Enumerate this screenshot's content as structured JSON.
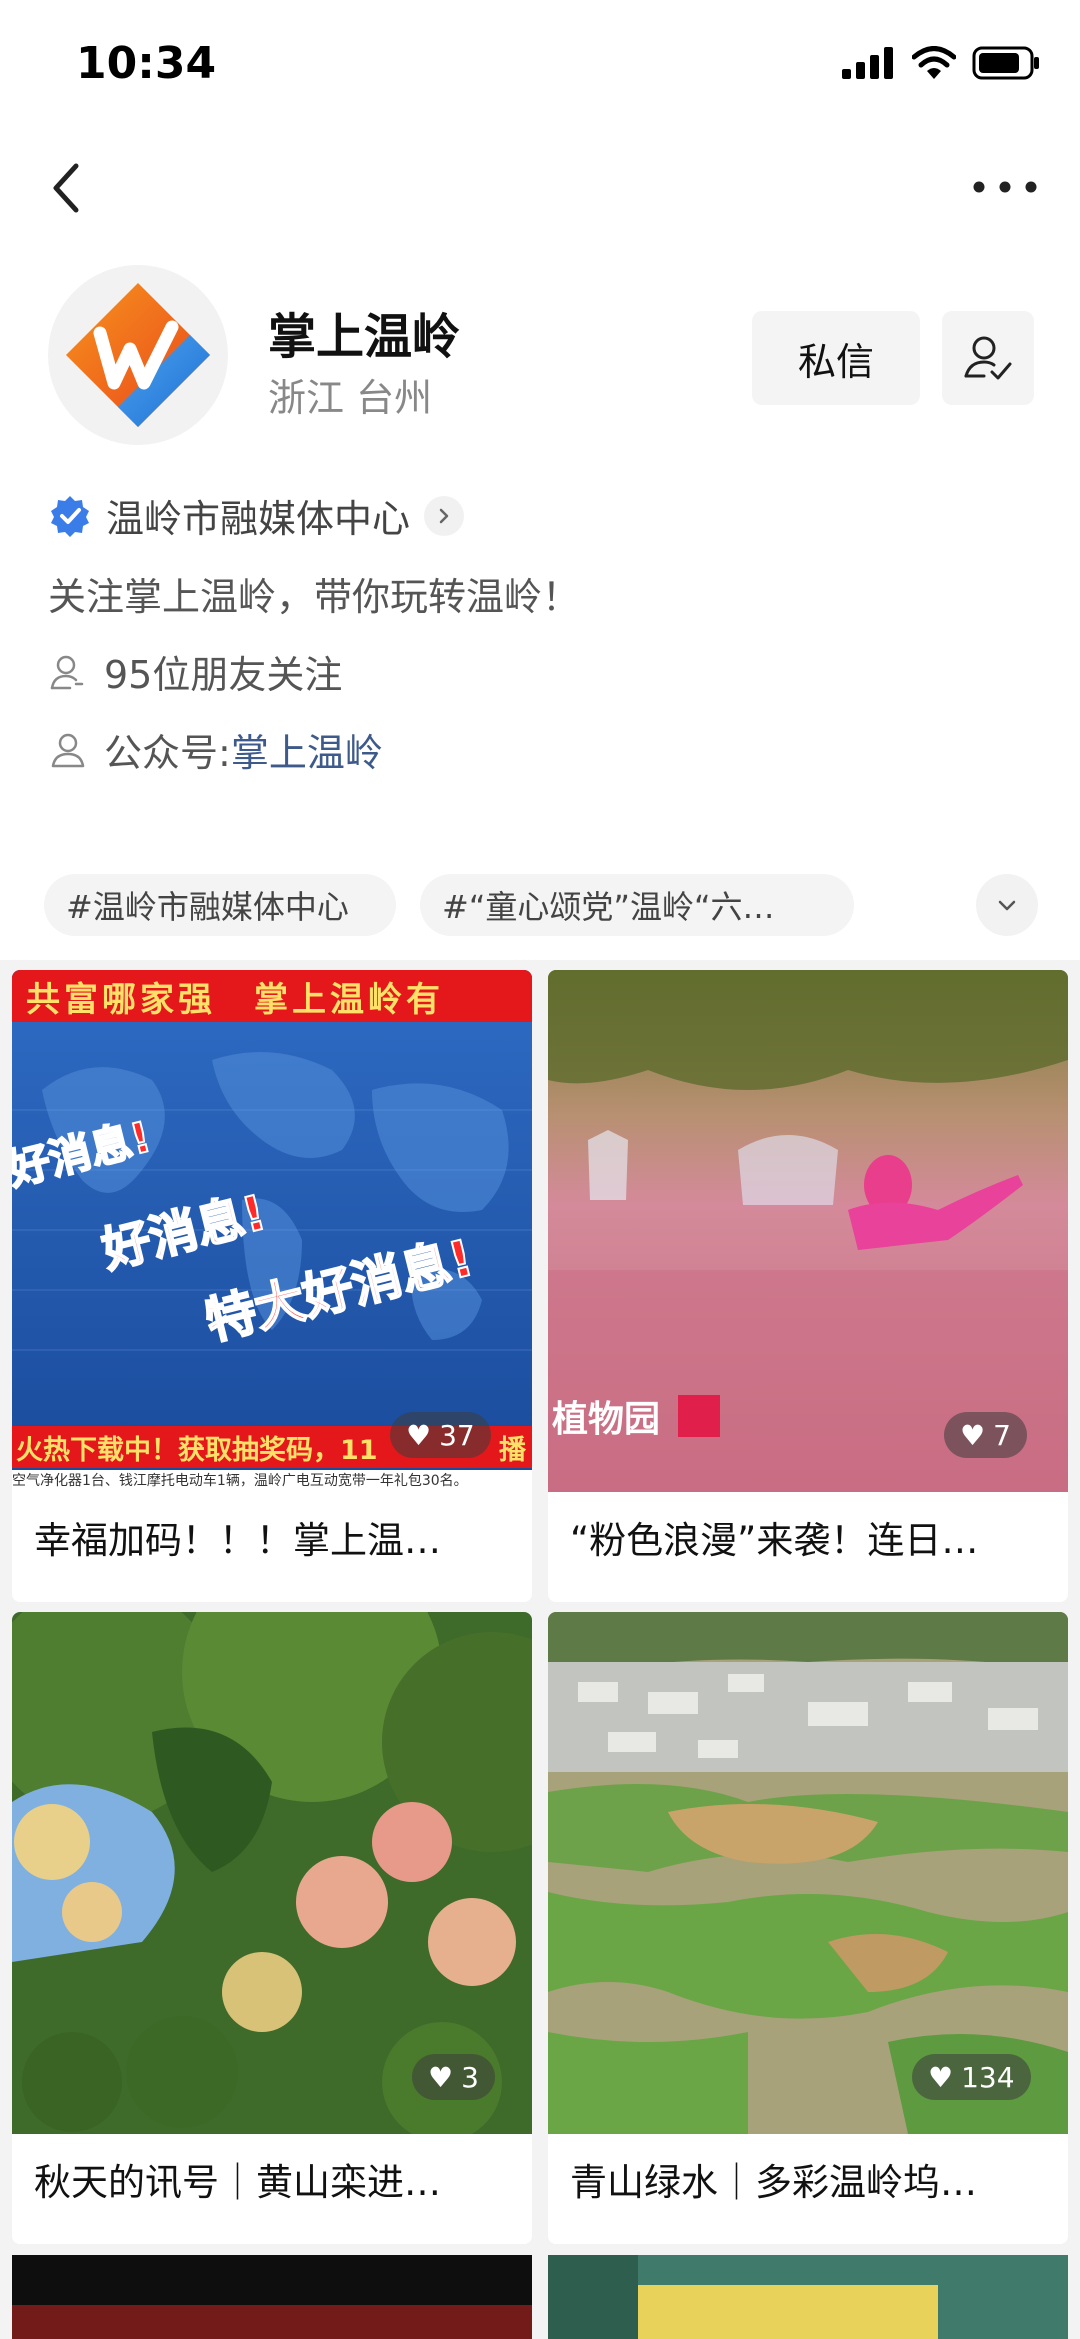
{
  "status_bar": {
    "time": "10:34"
  },
  "profile": {
    "name": "掌上温岭",
    "location": "浙江 台州",
    "message_button": "私信",
    "verified_org": "温岭市融媒体中心",
    "bio": "关注掌上温岭，带你玩转温岭！",
    "friends_follow": "95位朋友关注",
    "gzh_label": "公众号: ",
    "gzh_name": "掌上温岭"
  },
  "tags": [
    "#温岭市融媒体中心",
    "#“童心颂党”温岭“六…"
  ],
  "feed": [
    {
      "title": "幸福加码！！！掌上温…",
      "likes": "37",
      "banner_top": "共富哪家强　掌上温岭有",
      "overlay_1": "好消息!",
      "overlay_2": "好消息!",
      "overlay_3": "特大好消息!",
      "banner_bottom": "火热下载中！获取抽奖码，11",
      "banner_extra": "播",
      "prize_line": "空气净化器1台、钱江摩托电动车1辆，温岭广电互动宽带一年礼包30名。"
    },
    {
      "title": "“粉色浪漫”来袭！连日…",
      "likes": "7",
      "caption": "植物园"
    },
    {
      "title": "秋天的讯号｜黄山栾进…",
      "likes": "3"
    },
    {
      "title": "青山绿水｜多彩温岭坞…",
      "likes": "134"
    }
  ],
  "colors": {
    "accent_blue": "#3b7de8",
    "link_blue": "#3d5a8a",
    "banner_red": "#e4171b"
  }
}
